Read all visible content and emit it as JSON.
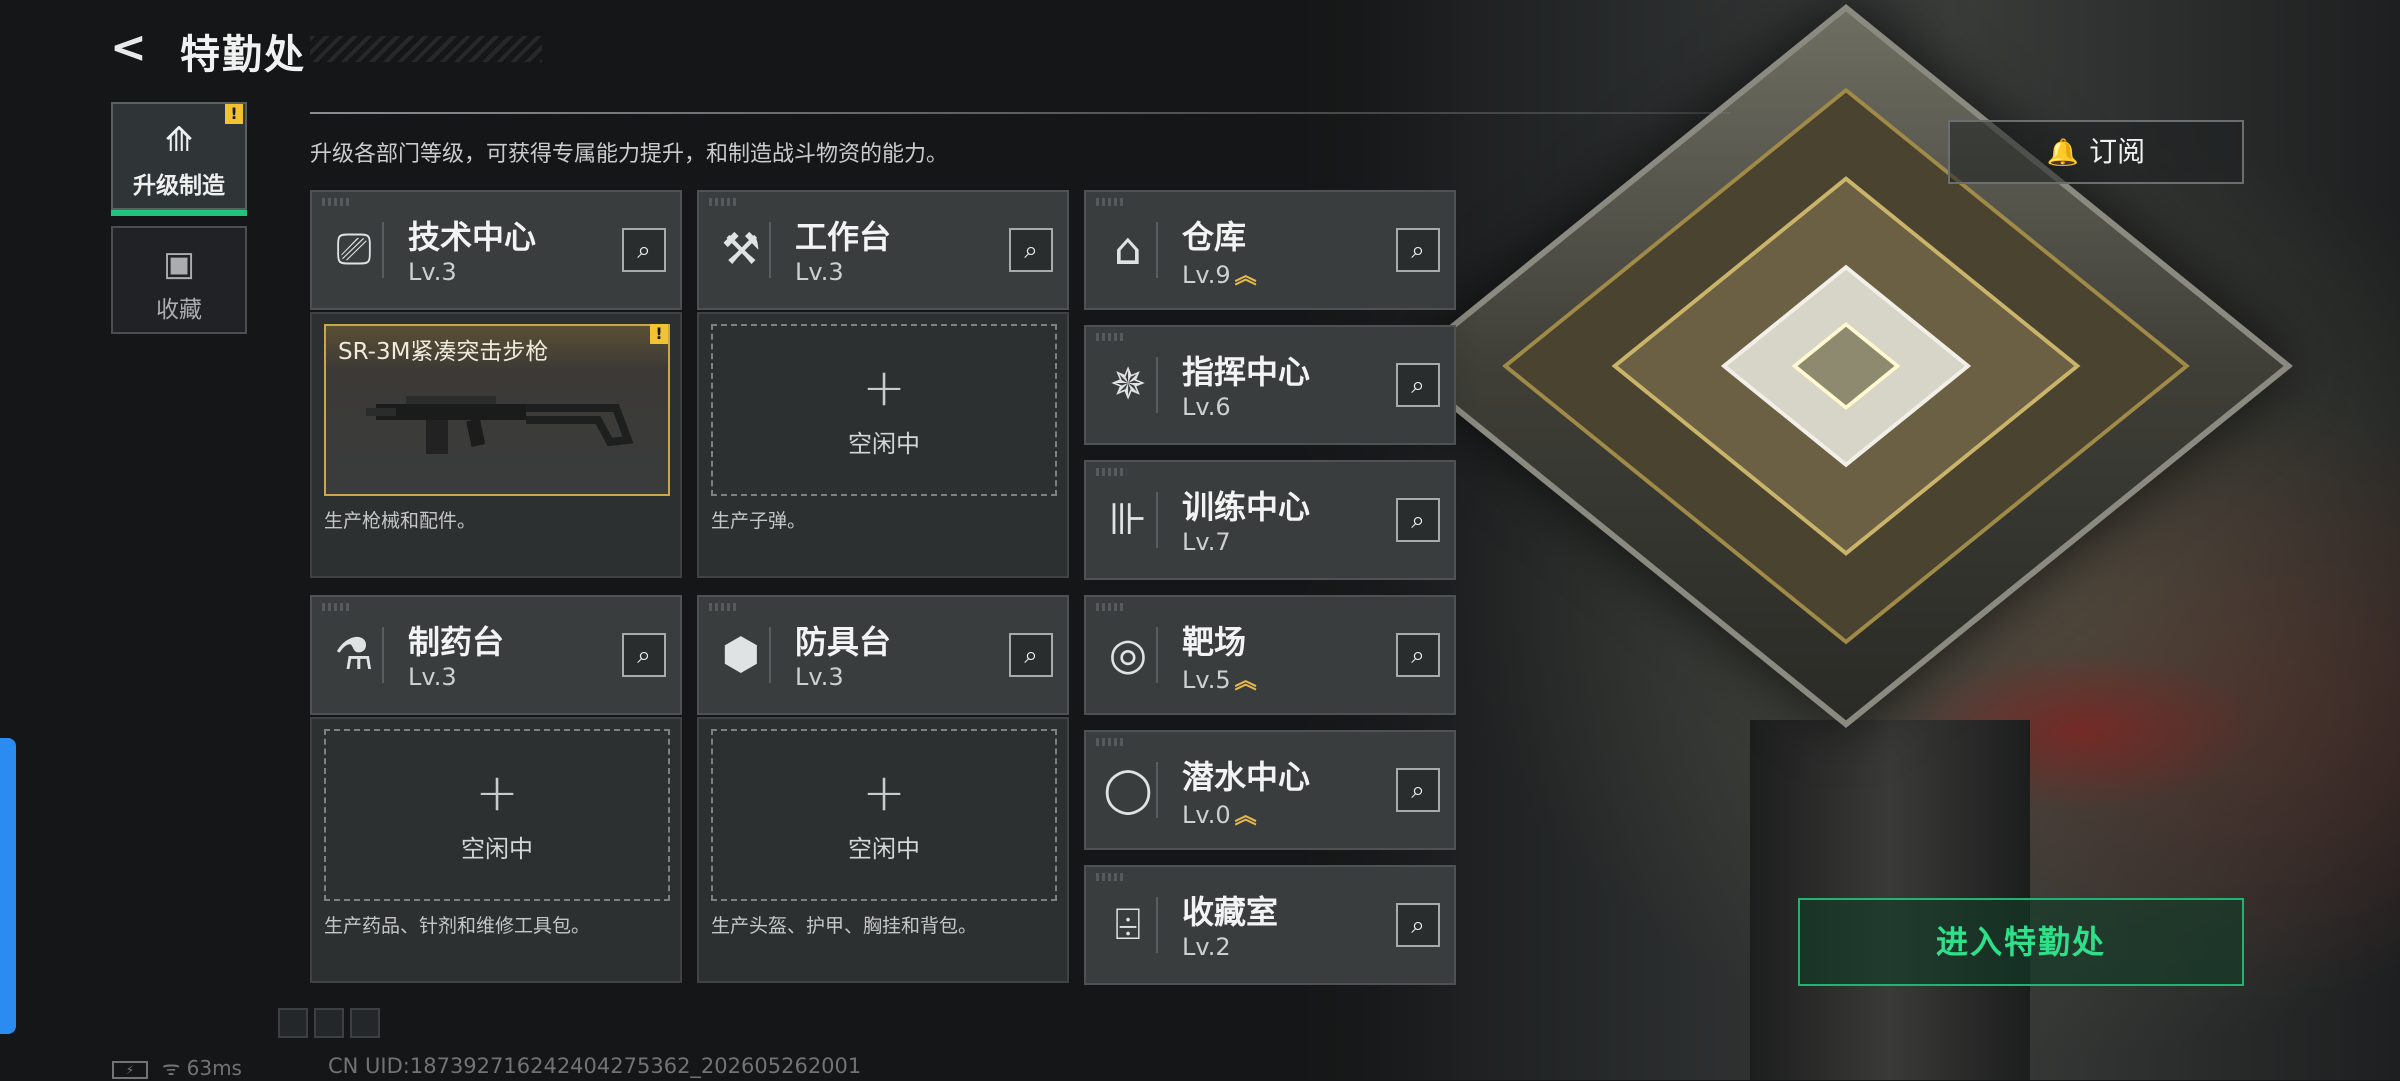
{
  "header": {
    "back_icon": "back-arrow-icon",
    "title": "特勤处"
  },
  "nav": [
    {
      "label": "升级制造",
      "icon": "upgrade-icon",
      "glyph": "⟰",
      "active": true,
      "alert": "!"
    },
    {
      "label": "收藏",
      "icon": "collection-icon",
      "glyph": "▣",
      "active": false
    }
  ],
  "description": "升级各部门等级，可获得专属能力提升，和制造战斗物资的能力。",
  "subscribe": {
    "icon": "bell-icon",
    "label": "订阅"
  },
  "production": [
    {
      "name": "技术中心",
      "level": "Lv.3",
      "icon": "tech-center-icon",
      "glyph": "⎚",
      "slot": {
        "filled": true,
        "item": "SR-3M紧凑突击步枪",
        "alert": "!"
      },
      "note": "生产枪械和配件。"
    },
    {
      "name": "工作台",
      "level": "Lv.3",
      "icon": "workbench-icon",
      "glyph": "⚒",
      "slot": {
        "filled": false,
        "idle": "空闲中"
      },
      "note": "生产子弹。"
    },
    {
      "name": "制药台",
      "level": "Lv.3",
      "icon": "pharmacy-icon",
      "glyph": "⚗",
      "slot": {
        "filled": false,
        "idle": "空闲中"
      },
      "note": "生产药品、针剂和维修工具包。"
    },
    {
      "name": "防具台",
      "level": "Lv.3",
      "icon": "armor-bench-icon",
      "glyph": "⬢",
      "slot": {
        "filled": false,
        "idle": "空闲中"
      },
      "note": "生产头盔、护甲、胸挂和背包。"
    }
  ],
  "departments": [
    {
      "name": "仓库",
      "level": "Lv.9",
      "icon": "warehouse-icon",
      "glyph": "⌂",
      "upgrade": true
    },
    {
      "name": "指挥中心",
      "level": "Lv.6",
      "icon": "command-center-icon",
      "glyph": "✵",
      "upgrade": false
    },
    {
      "name": "训练中心",
      "level": "Lv.7",
      "icon": "training-center-icon",
      "glyph": "⊪",
      "upgrade": false
    },
    {
      "name": "靶场",
      "level": "Lv.5",
      "icon": "shooting-range-icon",
      "glyph": "◎",
      "upgrade": true
    },
    {
      "name": "潜水中心",
      "level": "Lv.0",
      "icon": "diving-center-icon",
      "glyph": "◯",
      "upgrade": true
    },
    {
      "name": "收藏室",
      "level": "Lv.2",
      "icon": "collection-room-icon",
      "glyph": "⌹",
      "upgrade": false
    }
  ],
  "search_glyph": "⌕",
  "plus_glyph": "+",
  "upgrade_glyph": "︽",
  "enter_button": "进入特勤处",
  "status": {
    "ping": "63ms",
    "uid": "CN UID:18739271624240427536​2_202605262001"
  },
  "colors": {
    "accent_green": "#2fe08a",
    "gold": "#c9a84b",
    "alert_yellow": "#f2c230"
  }
}
